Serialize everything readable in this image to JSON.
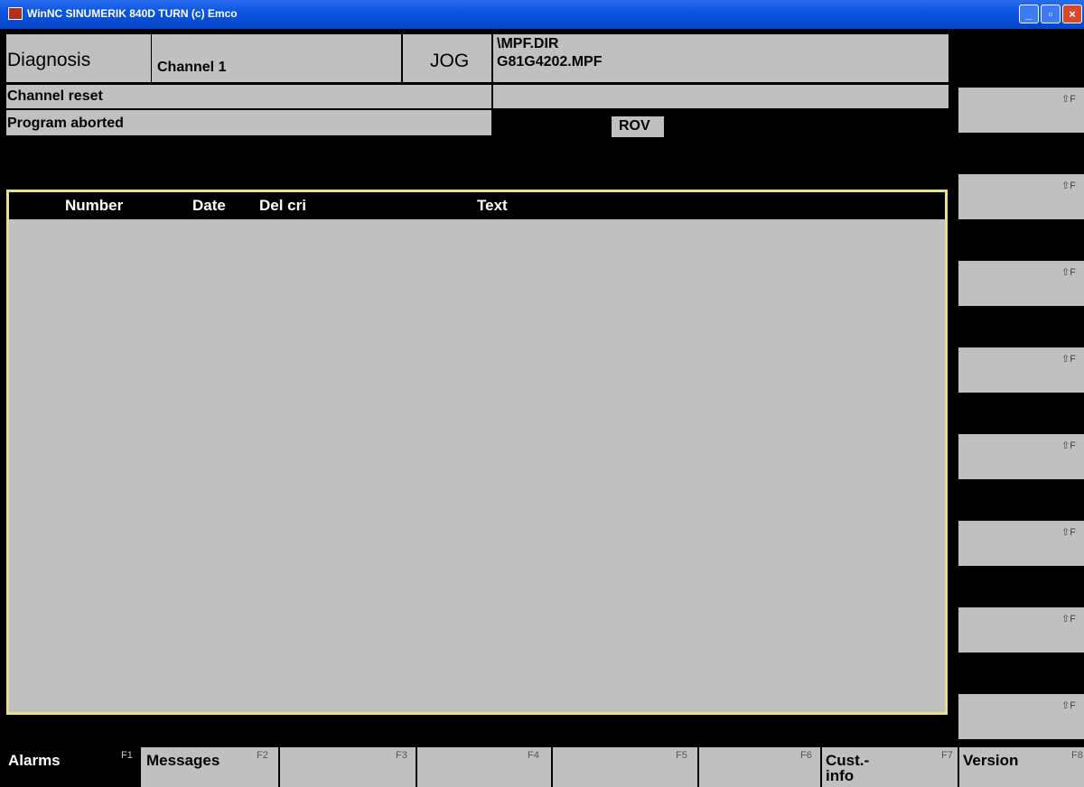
{
  "window": {
    "title": "WinNC SINUMERIK 840D TURN (c) Emco",
    "controls": {
      "minimize": "_",
      "maximize": "▫",
      "close": "×"
    }
  },
  "header": {
    "area": "Diagnosis",
    "channel": "Channel 1",
    "mode": "JOG",
    "path_line1": "\\MPF.DIR",
    "path_line2": "G81G4202.MPF"
  },
  "status": {
    "channel_state": "Channel reset",
    "program_state": "Program aborted",
    "override": "ROV"
  },
  "alarm_list": {
    "columns": [
      "Number",
      "Date",
      "Del cri",
      "Text"
    ],
    "rows": []
  },
  "right_softkeys": [
    {
      "hint": "⇧F"
    },
    {
      "hint": "⇧F"
    },
    {
      "hint": "⇧F"
    },
    {
      "hint": "⇧F"
    },
    {
      "hint": "⇧F"
    },
    {
      "hint": "⇧F"
    },
    {
      "hint": "⇧F"
    },
    {
      "hint": "⇧F"
    }
  ],
  "bottom_softkeys": [
    {
      "label": "Alarms",
      "fkey": "F1"
    },
    {
      "label": "Messages",
      "fkey": "F2"
    },
    {
      "label": "",
      "fkey": "F3"
    },
    {
      "label": "",
      "fkey": "F4"
    },
    {
      "label": "",
      "fkey": "F5"
    },
    {
      "label": "",
      "fkey": "F6"
    },
    {
      "label": "Cust.-\ninfo",
      "fkey": "F7"
    },
    {
      "label": "Version",
      "fkey": "F8"
    }
  ],
  "colors": {
    "panel_gray": "#c0c0c0",
    "panel_border": "#e8e08c",
    "background": "#000000"
  }
}
